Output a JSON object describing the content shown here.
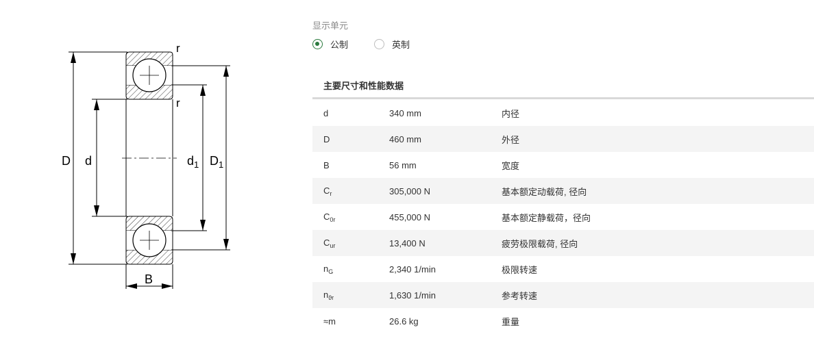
{
  "drawing": {
    "labels": {
      "r_top": "r",
      "r_mid": "r",
      "D": "D",
      "d": "d",
      "d1_base": "d",
      "d1_sub": "1",
      "D1_base": "D",
      "D1_sub": "1",
      "B": "B"
    }
  },
  "units": {
    "title": "显示单元",
    "options": [
      {
        "label": "公制",
        "selected": true
      },
      {
        "label": "英制",
        "selected": false
      }
    ]
  },
  "specs": {
    "title": "主要尺寸和性能数据",
    "rows": [
      {
        "sym": "d",
        "sub": "",
        "value": "340 mm",
        "desc": "内径"
      },
      {
        "sym": "D",
        "sub": "",
        "value": "460 mm",
        "desc": "外径"
      },
      {
        "sym": "B",
        "sub": "",
        "value": "56 mm",
        "desc": "宽度"
      },
      {
        "sym": "C",
        "sub": "r",
        "value": "305,000 N",
        "desc": "基本额定动载荷, 径向"
      },
      {
        "sym": "C",
        "sub": "0r",
        "value": "455,000 N",
        "desc": "基本额定静载荷，径向"
      },
      {
        "sym": "C",
        "sub": "ur",
        "value": "13,400 N",
        "desc": "疲劳极限载荷, 径向"
      },
      {
        "sym": "n",
        "sub": "G",
        "value": "2,340 1/min",
        "desc": "极限转速"
      },
      {
        "sym": "n",
        "sub": "ϑr",
        "value": "1,630 1/min",
        "desc": "参考转速"
      },
      {
        "sym": "≈m",
        "sub": "",
        "value": "26.6 kg",
        "desc": "重量"
      }
    ]
  },
  "colors": {
    "accent": "#2b7a3e",
    "stripe": "#f4f4f4",
    "rule": "#d9d9d9"
  }
}
